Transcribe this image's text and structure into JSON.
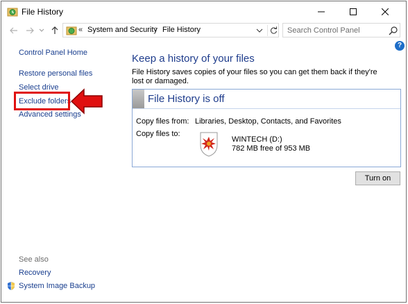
{
  "window": {
    "title": "File History"
  },
  "address": {
    "lead_sep": "«",
    "breadcrumbs": [
      "System and Security",
      "File History"
    ],
    "sep": "›",
    "search_placeholder": "Search Control Panel"
  },
  "help_label": "?",
  "nav": {
    "home": "Control Panel Home",
    "items": [
      "Restore personal files",
      "Select drive",
      "Exclude folders",
      "Advanced settings"
    ],
    "see_also_heading": "See also",
    "see_also": [
      "Recovery",
      "System Image Backup"
    ]
  },
  "main": {
    "heading": "Keep a history of your files",
    "description": "File History saves copies of your files so you can get them back if they're lost or damaged.",
    "status_title": "File History is off",
    "copy_from_label": "Copy files from:",
    "copy_from_value": "Libraries, Desktop, Contacts, and Favorites",
    "copy_to_label": "Copy files to:",
    "drive_name": "WINTECH (D:)",
    "drive_space": "782 MB free of 953 MB",
    "turn_on_label": "Turn on"
  },
  "colors": {
    "link": "#1a3f8f",
    "heading": "#1e3c8c",
    "highlight": "#e01010"
  }
}
